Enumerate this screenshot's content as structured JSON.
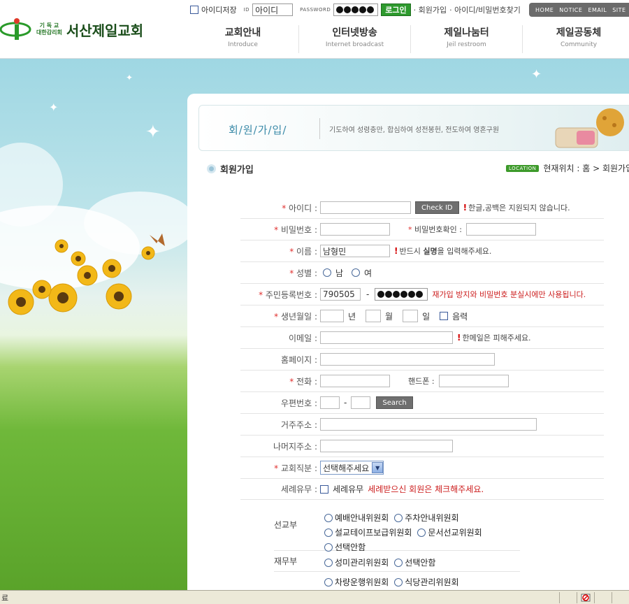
{
  "header": {
    "logo_small_line1": "기 독 교",
    "logo_small_line2": "대한감리회",
    "logo_name": "서산제일교회",
    "logo_mark_text": "S Jnc.ors"
  },
  "login": {
    "save_id_label": "아이디저장",
    "id_label": "ID",
    "id_value": "아이디",
    "password_label": "PASSWORD",
    "login_button": "로그인",
    "join_link": "· 회원가입",
    "find_link": "· 아이디/비밀번호찾기"
  },
  "global_nav": [
    "HOME",
    "NOTICE",
    "EMAIL",
    "SITE"
  ],
  "main_nav": [
    {
      "ko": "교회안내",
      "en": "Introduce"
    },
    {
      "ko": "인터넷방송",
      "en": "Internet broadcast"
    },
    {
      "ko": "제일나눔터",
      "en": "Jeil restroom"
    },
    {
      "ko": "제일공동체",
      "en": "Community"
    }
  ],
  "banner": {
    "title": "회/원/가/입/",
    "slogan": "기도하여 성령충만, 합심하여 성전봉헌, 전도하여 영혼구원"
  },
  "section": {
    "title": "회원가입",
    "location_badge": "LOCATION",
    "location_text": "현재위치 : 홈 > 회원가입"
  },
  "form": {
    "id": {
      "label": "아이디 :",
      "button": "Check ID",
      "note": "한글,공백은 지원되지 않습니다."
    },
    "password": {
      "label": "비밀번호 :",
      "confirm_label": "비밀번호확인 :"
    },
    "name": {
      "label": "이름 :",
      "value": "남형민",
      "note_pre": "반드시 ",
      "note_bold": "실명",
      "note_post": "을 입력해주세요."
    },
    "gender": {
      "label": "성별 :",
      "male": "남",
      "female": "여"
    },
    "ssn": {
      "label": "주민등록번호 :",
      "front": "790505",
      "dash": "-",
      "note": "재가입 방지와 비밀번호 분실시에만 사용됩니다."
    },
    "birth": {
      "label": "생년월일 :",
      "year": "년",
      "month": "월",
      "day": "일",
      "lunar": "음력"
    },
    "email": {
      "label": "이메일 :",
      "note": "한메일은 피해주세요."
    },
    "homepage": {
      "label": "홈페이지 :"
    },
    "phone": {
      "label": "전화 :",
      "mobile_label": "핸드폰 :"
    },
    "zipcode": {
      "label": "우편번호 :",
      "dash": "-",
      "button": "Search"
    },
    "address": {
      "label": "거주주소 :"
    },
    "address2": {
      "label": "나머지주소 :"
    },
    "position": {
      "label": "교회직분 :",
      "selected": "선택해주세요"
    },
    "baptism": {
      "label": "세례유무 :",
      "check_label": "세례유무",
      "note": "세례받으신 회원은 체크해주세요."
    }
  },
  "departments": [
    {
      "name": "선교부",
      "options": [
        "예배안내위원회",
        "주차안내위원회",
        "설교테이프보급위원회",
        "문서선교위원회",
        "선택안함"
      ]
    },
    {
      "name": "재무부",
      "options": [
        "성미관리위원회",
        "선택안함"
      ]
    },
    {
      "name": "",
      "options": [
        "차량운행위원회",
        "식당관리위원회"
      ]
    }
  ],
  "statusbar": {
    "text": "료"
  }
}
